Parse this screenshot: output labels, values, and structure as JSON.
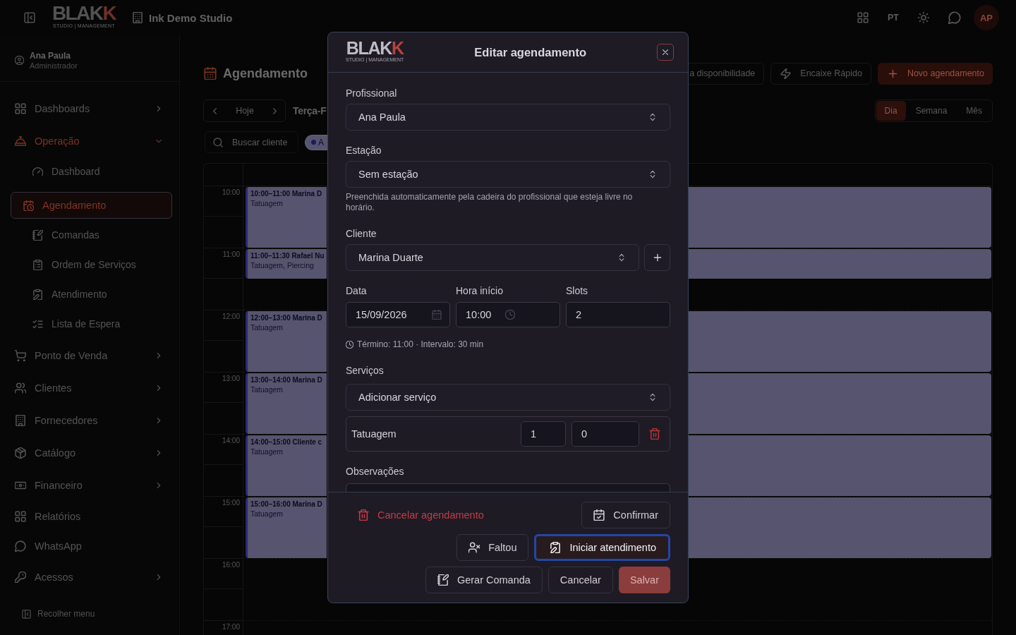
{
  "topbar": {
    "logo": {
      "text": "BLAK",
      "accent": "K",
      "tagline": "STUDIO | MANAGEMENT"
    },
    "workspace": "Ink Demo Studio",
    "language": "PT",
    "avatar": "AP"
  },
  "sidebar": {
    "user": {
      "name": "Ana Paula",
      "role": "Administrador"
    },
    "items": [
      {
        "label": "Dashboards",
        "active": false,
        "expandable": true,
        "expanded": false
      },
      {
        "label": "Operação",
        "active": true,
        "expandable": true,
        "expanded": true,
        "children": [
          {
            "label": "Dashboard",
            "selected": false
          },
          {
            "label": "Agendamento",
            "selected": true
          },
          {
            "label": "Comandas",
            "selected": false
          },
          {
            "label": "Ordem de Serviços",
            "selected": false
          },
          {
            "label": "Atendimento",
            "selected": false
          },
          {
            "label": "Lista de Espera",
            "selected": false
          }
        ]
      },
      {
        "label": "Ponto de Venda",
        "active": false,
        "expandable": true,
        "expanded": false
      },
      {
        "label": "Clientes",
        "active": false,
        "expandable": true,
        "expanded": false
      },
      {
        "label": "Fornecedores",
        "active": false,
        "expandable": true,
        "expanded": false
      },
      {
        "label": "Catálogo",
        "active": false,
        "expandable": true,
        "expanded": false
      },
      {
        "label": "Financeiro",
        "active": false,
        "expandable": true,
        "expanded": false
      },
      {
        "label": "Relatórios",
        "active": false,
        "expandable": false
      },
      {
        "label": "WhatsApp",
        "active": false,
        "expandable": false
      },
      {
        "label": "Acessos",
        "active": false,
        "expandable": true,
        "expanded": false
      }
    ],
    "collapse": "Recolher menu"
  },
  "page": {
    "title": "Agendamento",
    "actions": [
      {
        "label": "a disponibilidade",
        "kind": "outline"
      },
      {
        "label": "Encaixe Rápido",
        "kind": "outline"
      },
      {
        "label": "Novo agendamento",
        "kind": "primary"
      }
    ],
    "today": "Hoje",
    "date": "Terça-F",
    "views": [
      {
        "label": "Dia",
        "selected": true
      },
      {
        "label": "Semana",
        "selected": false
      },
      {
        "label": "Mês",
        "selected": false
      }
    ],
    "search": {
      "placeholder": "Buscar cliente"
    },
    "filter": "A",
    "calendar": {
      "hours": [
        {
          "label": "10:00",
          "appointments": [
            {
              "title": "10:00–11:00 Marina D",
              "services": "Tatuagem",
              "kind": "hour"
            }
          ]
        },
        {
          "label": "11:00",
          "appointments": [
            {
              "title": "11:00–11:30 Rafael Nu",
              "services": "Tatuagem, Piercing",
              "kind": "half"
            }
          ]
        },
        {
          "label": "12:00",
          "appointments": [
            {
              "title": "12:00–13:00 Marina D",
              "services": "Tatuagem",
              "kind": "hour"
            }
          ]
        },
        {
          "label": "13:00",
          "appointments": [
            {
              "title": "13:00–14:00 Marina D",
              "services": "Tatuagem",
              "kind": "hour"
            }
          ]
        },
        {
          "label": "14:00",
          "appointments": [
            {
              "title": "14:00–15:00 Cliente c",
              "services": "Tatuagem",
              "kind": "hour"
            }
          ]
        },
        {
          "label": "15:00",
          "appointments": [
            {
              "title": "15:00–16:00 Marina D",
              "services": "Tatuagem",
              "kind": "hour"
            }
          ]
        },
        {
          "label": "16:00"
        },
        {
          "label": "17:00"
        }
      ]
    }
  },
  "modal": {
    "logo": {
      "text": "BLAK",
      "accent": "K",
      "tagline": "STUDIO | MANAGEMENT"
    },
    "title": "Editar agendamento",
    "professional": {
      "label": "Profissional",
      "value": "Ana Paula"
    },
    "station": {
      "label": "Estação",
      "value": "Sem estação",
      "hint": "Preenchida automaticamente pela cadeira do profissional que esteja livre no horário."
    },
    "client": {
      "label": "Cliente",
      "value": "Marina Duarte"
    },
    "date": {
      "label": "Data",
      "value": "15/09/2026"
    },
    "start": {
      "label": "Hora início",
      "value": "10:00"
    },
    "slots": {
      "label": "Slots",
      "value": "2"
    },
    "summary": "Término: 11:00 · Intervalo: 30 min",
    "services": {
      "label": "Serviços",
      "value": "Adicionar serviço",
      "items": [
        {
          "name": "Tatuagem",
          "quantity": "1",
          "price": "0"
        }
      ]
    },
    "notes": {
      "label": "Observações"
    },
    "footer": [
      [
        {
          "label": "Cancelar agendamento",
          "kind": "danger",
          "focused": false,
          "disabled": false
        },
        {
          "label": "Confirmar",
          "kind": "outline",
          "focused": false,
          "disabled": false
        }
      ],
      [
        {
          "label": "Faltou",
          "kind": "outline",
          "focused": false,
          "disabled": false
        },
        {
          "label": "Iniciar atendimento",
          "kind": "dark",
          "focused": true,
          "disabled": false
        }
      ],
      [
        {
          "label": "Gerar Comanda",
          "kind": "outline",
          "focused": false,
          "disabled": false
        },
        {
          "label": "Cancelar",
          "kind": "outline",
          "focused": false,
          "disabled": false
        },
        {
          "label": "Salvar",
          "kind": "primary",
          "focused": false,
          "disabled": true
        }
      ]
    ]
  }
}
